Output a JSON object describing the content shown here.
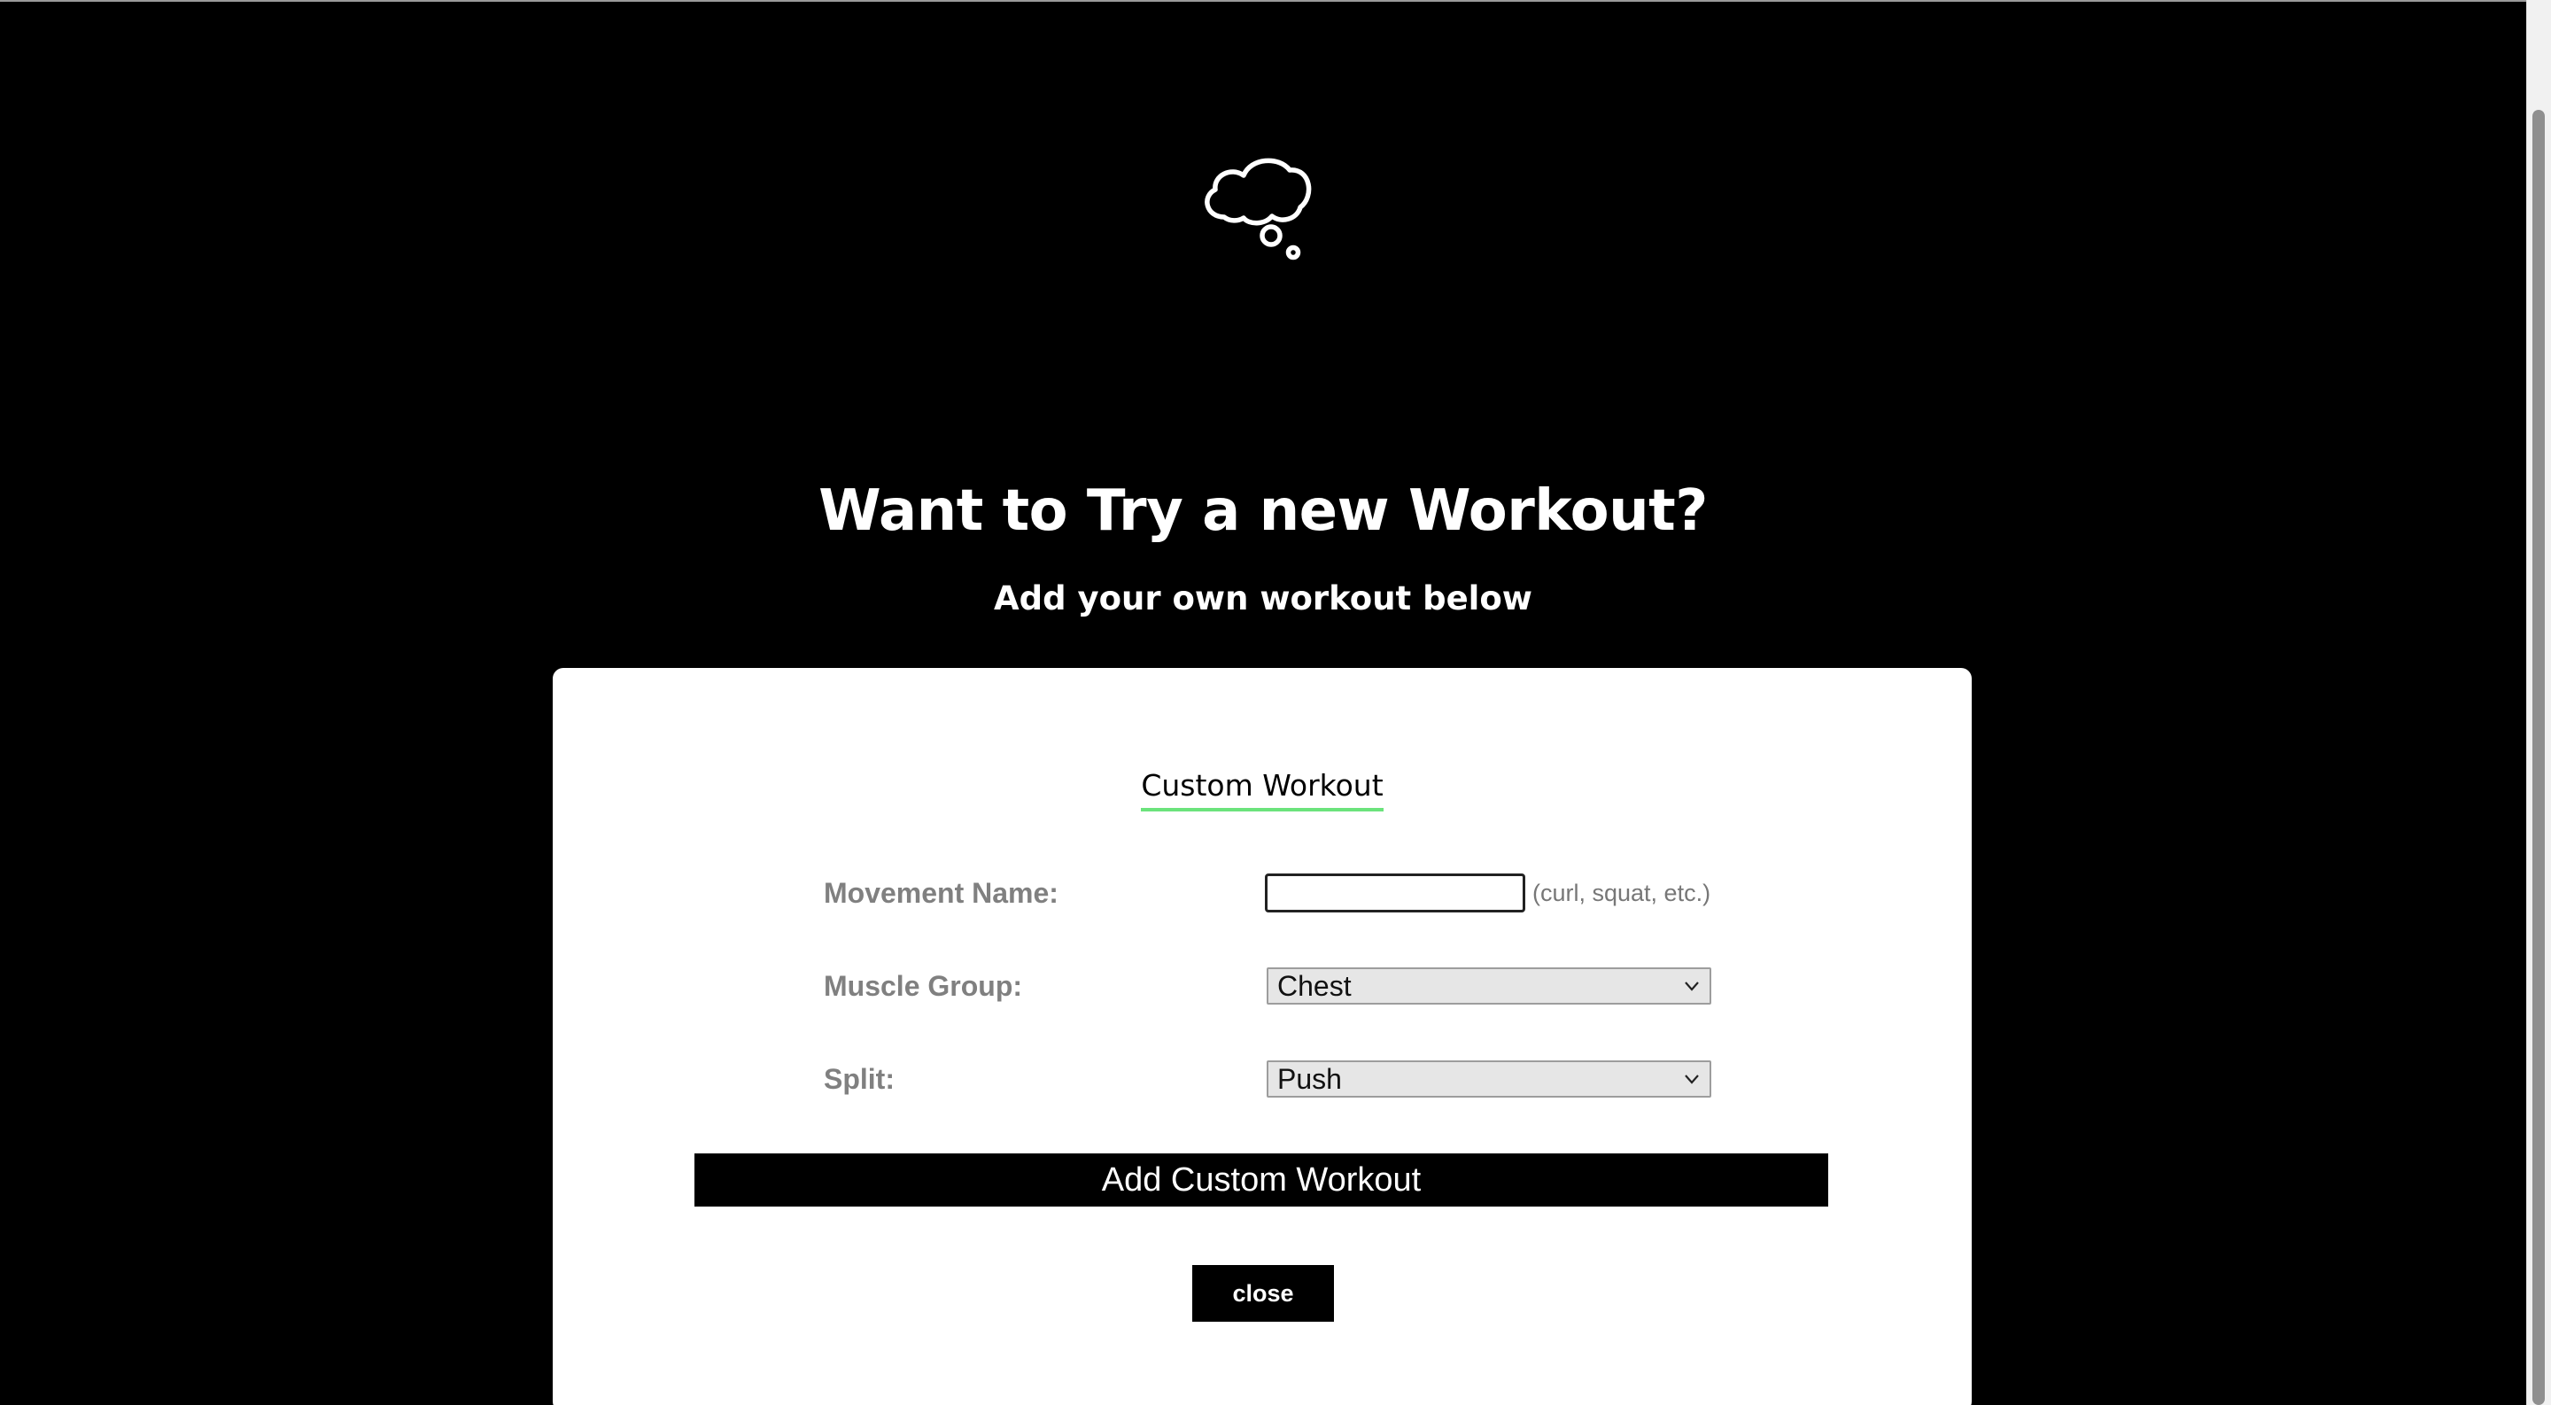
{
  "hero": {
    "icon": "thought-cloud-icon",
    "title": "Want to Try a new Workout?",
    "subtitle": "Add your own workout below"
  },
  "form": {
    "title": "Custom Workout",
    "title_underline_color": "#6be37c",
    "movement": {
      "label": "Movement Name:",
      "value": "",
      "hint": "(curl, squat, etc.)"
    },
    "muscle_group": {
      "label": "Muscle Group:",
      "selected": "Chest"
    },
    "split": {
      "label": "Split:",
      "selected": "Push"
    },
    "submit_label": "Add Custom Workout",
    "close_label": "close"
  },
  "colors": {
    "background": "#000000",
    "card": "#ffffff",
    "label": "#808080",
    "accent": "#6be37c"
  }
}
